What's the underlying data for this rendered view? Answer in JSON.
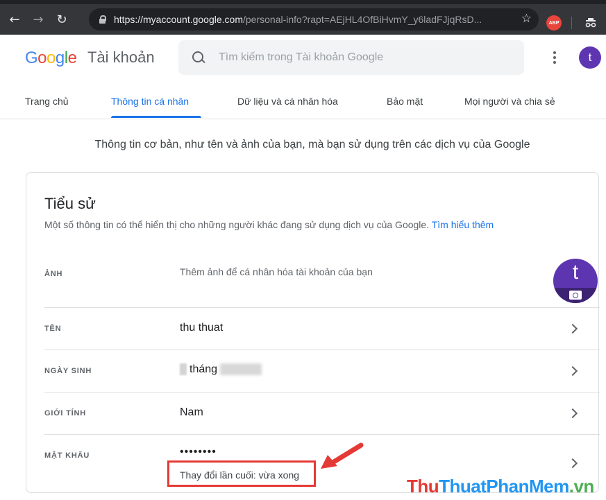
{
  "browser": {
    "url_host": "https://myaccount.google.com",
    "url_rest": "/personal-info?rapt=AEjHL4OfBiHvmY_y6ladFJjqRsD...",
    "abp_label": "ABP"
  },
  "header": {
    "logo_letters": [
      "G",
      "o",
      "o",
      "g",
      "l",
      "e"
    ],
    "logo_colors": [
      "#4285F4",
      "#EA4335",
      "#FBBC05",
      "#4285F4",
      "#34A853",
      "#EA4335"
    ],
    "title": "Tài khoản",
    "search_placeholder": "Tìm kiếm trong Tài khoản Google",
    "avatar_letter": "t"
  },
  "tabs": [
    {
      "label": "Trang chủ",
      "active": false
    },
    {
      "label": "Thông tin cá nhân",
      "active": true
    },
    {
      "label": "Dữ liệu và cá nhân hóa",
      "active": false
    },
    {
      "label": "Bảo mật",
      "active": false
    },
    {
      "label": "Mọi người và chia sẻ",
      "active": false
    }
  ],
  "page_description": "Thông tin cơ bản, như tên và ảnh của bạn, mà bạn sử dụng trên các dịch vụ của Google",
  "profile_card": {
    "title": "Tiểu sử",
    "subtitle": "Một số thông tin có thể hiển thị cho những người khác đang sử dụng dịch vụ của Google.",
    "learn_more": "Tìm hiểu thêm",
    "photo": {
      "label": "ẢNH",
      "value": "Thêm ảnh để cá nhân hóa tài khoản của bạn",
      "avatar_letter": "t"
    },
    "name": {
      "label": "TÊN",
      "value": "thu thuat"
    },
    "birthday": {
      "label": "NGÀY SINH",
      "value": "tháng"
    },
    "gender": {
      "label": "GIỚI TÍNH",
      "value": "Nam"
    },
    "password": {
      "label": "MẬT KHẨU",
      "value": "••••••••",
      "last_changed": "Thay đổi lần cuối: vừa xong"
    }
  },
  "watermark": {
    "part1": "Thu",
    "part2": "ThuatPhanMem",
    "part3": ".vn"
  }
}
